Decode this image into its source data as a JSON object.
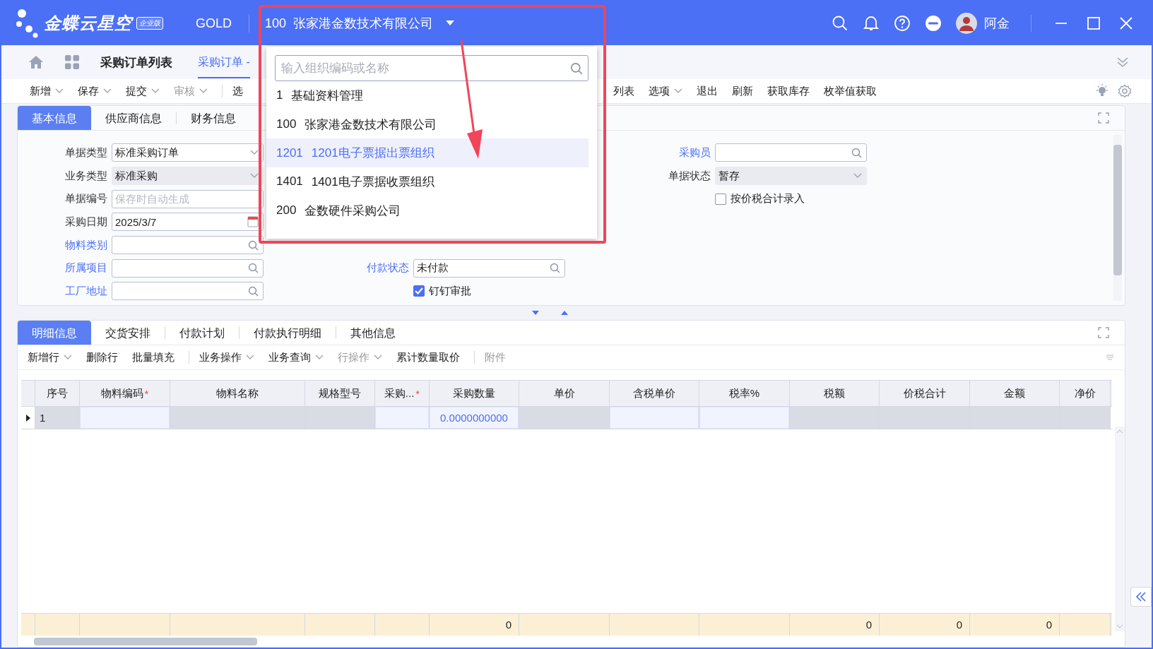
{
  "app": {
    "logo": "金蝶云星空",
    "edition": "企业版",
    "tenant": "GOLD",
    "org": "100  张家港金数技术有限公司",
    "user": "阿金"
  },
  "nav_tabs": [
    {
      "label": "采购订单列表",
      "selected": false
    },
    {
      "label": "采购订单 -",
      "selected": true
    }
  ],
  "toolbar": {
    "left": [
      [
        {
          "label": "新增",
          "menu": true,
          "disabled": false
        },
        {
          "label": "保存",
          "menu": true,
          "disabled": false
        },
        {
          "label": "提交",
          "menu": true,
          "disabled": false
        },
        {
          "label": "审核",
          "menu": true,
          "disabled": true
        }
      ],
      [
        {
          "label": "选",
          "menu": false,
          "disabled": false
        }
      ]
    ],
    "right": [
      {
        "label": "列表",
        "menu": false,
        "disabled": false
      },
      {
        "label": "选项",
        "menu": true,
        "disabled": false
      },
      {
        "label": "退出",
        "menu": false,
        "disabled": false
      },
      {
        "label": "刷新",
        "menu": false,
        "disabled": false
      },
      {
        "label": "获取库存",
        "menu": false,
        "disabled": false
      },
      {
        "label": "枚举值获取",
        "menu": false,
        "disabled": false
      }
    ]
  },
  "org_dropdown": {
    "placeholder": "输入组织编码或名称",
    "items": [
      {
        "code": "1",
        "name": "基础资料管理",
        "selected": false
      },
      {
        "code": "100",
        "name": "张家港金数技术有限公司",
        "selected": false
      },
      {
        "code": "1201",
        "name": "1201电子票据出票组织",
        "selected": true
      },
      {
        "code": "1401",
        "name": "1401电子票据收票组织",
        "selected": false
      },
      {
        "code": "200",
        "name": "金数硬件采购公司",
        "selected": false
      }
    ]
  },
  "header_form": {
    "tabs": [
      {
        "label": "基本信息",
        "selected": true
      },
      {
        "label": "供应商信息",
        "selected": false
      },
      {
        "label": "财务信息",
        "selected": false
      }
    ],
    "columns": [
      [
        {
          "kind": "select",
          "label": "单据类型",
          "link": false,
          "disabled": false,
          "value": "标准采购订单"
        },
        {
          "kind": "select",
          "label": "业务类型",
          "link": false,
          "disabled": true,
          "value": "标准采购"
        },
        {
          "kind": "text",
          "label": "单据编号",
          "link": false,
          "disabled": false,
          "placeholder": "保存时自动生成"
        },
        {
          "kind": "date",
          "label": "采购日期",
          "link": false,
          "disabled": false,
          "value": "2025/3/7"
        },
        {
          "kind": "lookup",
          "label": "物料类别",
          "link": true,
          "disabled": false
        },
        {
          "kind": "lookup",
          "label": "所属项目",
          "link": true,
          "disabled": false
        },
        {
          "kind": "lookup",
          "label": "工厂地址",
          "link": true,
          "disabled": false
        }
      ],
      [
        {
          "kind": "gap"
        },
        {
          "kind": "gap"
        },
        {
          "kind": "gap"
        },
        {
          "kind": "gap"
        },
        {
          "kind": "gap"
        },
        {
          "kind": "lookup",
          "label": "付款状态",
          "link": true,
          "disabled": false,
          "value": "未付款"
        },
        {
          "kind": "checkbox",
          "label": "钉钉审批",
          "checked": true
        }
      ],
      [
        {
          "kind": "lookup",
          "label": "采购员",
          "link": true,
          "disabled": false
        },
        {
          "kind": "select",
          "label": "单据状态",
          "link": false,
          "disabled": true,
          "value": "暂存"
        },
        {
          "kind": "checkbox",
          "label": "按价税合计录入",
          "checked": false
        }
      ]
    ]
  },
  "detail": {
    "tabs": [
      {
        "label": "明细信息",
        "selected": true
      },
      {
        "label": "交货安排",
        "selected": false
      },
      {
        "label": "付款计划",
        "selected": false
      },
      {
        "label": "付款执行明细",
        "selected": false
      },
      {
        "label": "其他信息",
        "selected": false
      }
    ],
    "toolbar": [
      [
        {
          "label": "新增行",
          "menu": true,
          "disabled": false
        },
        {
          "label": "删除行",
          "menu": false,
          "disabled": false
        },
        {
          "label": "批量填充",
          "menu": false,
          "disabled": false
        }
      ],
      [
        {
          "label": "业务操作",
          "menu": true,
          "disabled": false
        },
        {
          "label": "业务查询",
          "menu": true,
          "disabled": false
        },
        {
          "label": "行操作",
          "menu": true,
          "disabled": true
        },
        {
          "label": "累计数量取价",
          "menu": false,
          "disabled": false
        }
      ],
      [
        {
          "label": "附件",
          "menu": false,
          "disabled": true
        }
      ]
    ],
    "columns": [
      {
        "label": "序号"
      },
      {
        "label": "物料编码",
        "mark": "*"
      },
      {
        "label": "物料名称"
      },
      {
        "label": "规格型号"
      },
      {
        "label": "采购...",
        "mark": "*"
      },
      {
        "label": "采购数量",
        "total": "0"
      },
      {
        "label": "单价"
      },
      {
        "label": "含税单价"
      },
      {
        "label": "税率%"
      },
      {
        "label": "税额",
        "total": "0"
      },
      {
        "label": "价税合计",
        "total": "0"
      },
      {
        "label": "金额",
        "total": "0"
      },
      {
        "label": "净价"
      }
    ],
    "rows": [
      {
        "cells": [
          {
            "value": "1",
            "editable": false
          },
          {
            "editable": true
          },
          {
            "editable": false
          },
          {
            "editable": false
          },
          {
            "editable": true
          },
          {
            "value": "0.0000000000",
            "editable": true
          },
          {
            "editable": false
          },
          {
            "editable": true
          },
          {
            "editable": true
          },
          {
            "editable": false
          },
          {
            "editable": false
          },
          {
            "editable": false
          },
          {
            "editable": false
          }
        ]
      }
    ]
  }
}
